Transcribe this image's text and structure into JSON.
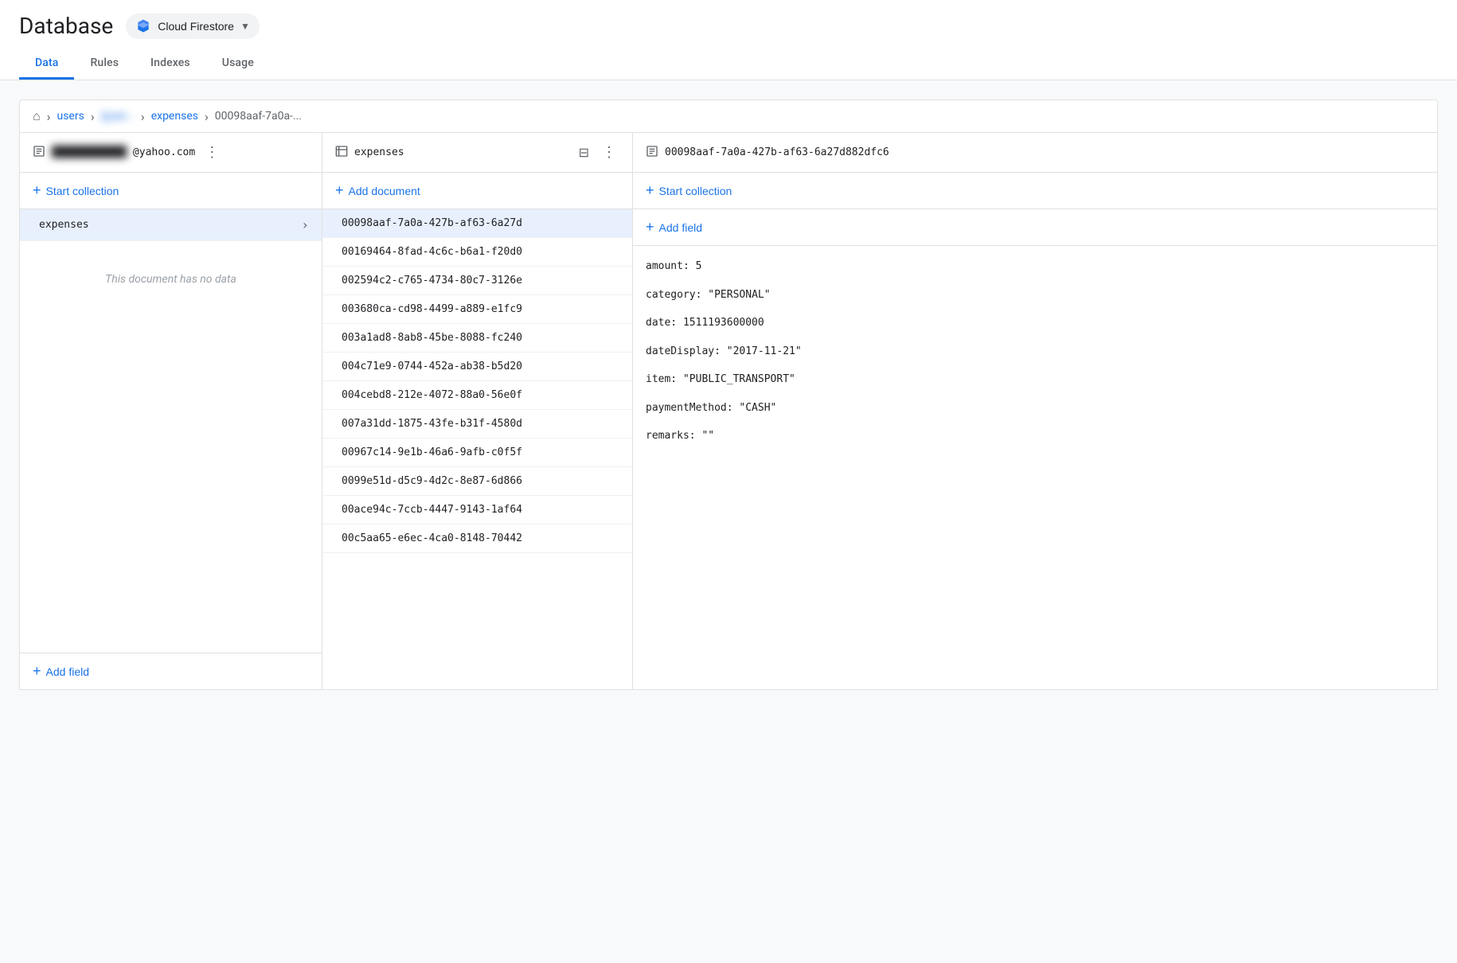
{
  "app": {
    "title": "Database",
    "service": "Cloud Firestore",
    "service_dropdown": true
  },
  "nav": {
    "tabs": [
      {
        "id": "data",
        "label": "Data",
        "active": true
      },
      {
        "id": "rules",
        "label": "Rules",
        "active": false
      },
      {
        "id": "indexes",
        "label": "Indexes",
        "active": false
      },
      {
        "id": "usage",
        "label": "Usage",
        "active": false
      }
    ]
  },
  "breadcrumb": {
    "home_icon": "🏠",
    "items": [
      {
        "label": "users",
        "type": "link"
      },
      {
        "label": "@yah...",
        "type": "blurred"
      },
      {
        "label": "expenses",
        "type": "link"
      },
      {
        "label": "00098aaf-7a0a-...",
        "type": "text"
      }
    ]
  },
  "column1": {
    "header_icon": "☰",
    "title_blurred": "██████████",
    "title_suffix": "@yahoo.com",
    "menu_icon": "⋮",
    "add_collection_label": "Start collection",
    "items": [
      {
        "label": "expenses",
        "selected": true
      }
    ],
    "no_data_text": "This document has no data",
    "add_field_label": "Add field"
  },
  "column2": {
    "header_icon": "☰",
    "title": "expenses",
    "filter_icon": "≡",
    "menu_icon": "⋮",
    "add_document_label": "Add document",
    "items": [
      {
        "id": "00098aaf-7a0a-427b-af63-6a27d",
        "selected": true
      },
      {
        "id": "00169464-8fad-4c6c-b6a1-f20d0"
      },
      {
        "id": "002594c2-c765-4734-80c7-3126e"
      },
      {
        "id": "003680ca-cd98-4499-a889-e1fc9"
      },
      {
        "id": "003a1ad8-8ab8-45be-8088-fc240"
      },
      {
        "id": "004c71e9-0744-452a-ab38-b5d20"
      },
      {
        "id": "004cebd8-212e-4072-88a0-56e0f"
      },
      {
        "id": "007a31dd-1875-43fe-b31f-4580d"
      },
      {
        "id": "00967c14-9e1b-46a6-9afb-c0f5f"
      },
      {
        "id": "0099e51d-d5c9-4d2c-8e87-6d866"
      },
      {
        "id": "00ace94c-7ccb-4447-9143-1af64"
      },
      {
        "id": "00c5aa65-e6ec-4ca0-8148-70442"
      }
    ]
  },
  "column3": {
    "header_icon": "☰",
    "doc_id": "00098aaf-7a0a-427b-af63-6a27d882dfc6",
    "add_collection_label": "Start collection",
    "add_field_label": "Add field",
    "fields": [
      {
        "key": "amount",
        "value": "5",
        "type": "number"
      },
      {
        "key": "category",
        "value": "\"PERSONAL\"",
        "type": "string"
      },
      {
        "key": "date",
        "value": "1511193600000",
        "type": "number"
      },
      {
        "key": "dateDisplay",
        "value": "\"2017-11-21\"",
        "type": "string"
      },
      {
        "key": "item",
        "value": "\"PUBLIC_TRANSPORT\"",
        "type": "string"
      },
      {
        "key": "paymentMethod",
        "value": "\"CASH\"",
        "type": "string"
      },
      {
        "key": "remarks",
        "value": "\"\"",
        "type": "string"
      }
    ]
  },
  "icons": {
    "plus": "+",
    "chevron_right": "›",
    "home": "⌂",
    "breadcrumb_sep": "›",
    "menu": "⋮",
    "filter": "⊟"
  }
}
